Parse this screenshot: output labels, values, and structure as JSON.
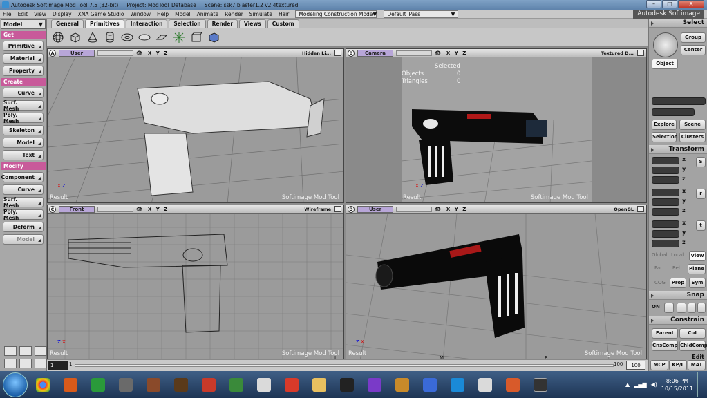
{
  "titlebar": {
    "app": "Autodesk Softimage Mod Tool 7.5 (32-bit)",
    "project": "Project: ModTool_Database",
    "scene": "Scene: ssk7 blaster1.2 v2.4textured",
    "buttons": [
      "–",
      "□",
      "X"
    ]
  },
  "menu": {
    "items": [
      "File",
      "Edit",
      "View",
      "Display",
      "XNA Game Studio",
      "Window",
      "Help",
      "Model",
      "Animate",
      "Render",
      "Simulate",
      "Hair"
    ],
    "construction_mode": "Modeling Construction Mode",
    "pass": "Default_Pass",
    "brand": "Autodesk Softimage"
  },
  "left": {
    "mode": "Model",
    "get_header": "Get",
    "get_items": [
      "Primitive",
      "Material",
      "Property"
    ],
    "create_header": "Create",
    "create_items": [
      "Curve",
      "Surf. Mesh",
      "Poly. Mesh",
      "Skeleton",
      "Model",
      "Text"
    ],
    "modify_header": "Modify",
    "modify_items": [
      "Component",
      "Curve",
      "Surf. Mesh",
      "Poly. Mesh",
      "Deform",
      "Model"
    ]
  },
  "tabs": [
    "General",
    "Primitives",
    "Interaction",
    "Selection",
    "Render",
    "Views",
    "Custom"
  ],
  "toolicons": [
    "sphere-icon",
    "cube-icon",
    "cone-icon",
    "cylinder-icon",
    "torus-icon",
    "disc-icon",
    "grid-icon",
    "null-icon",
    "soccer-icon",
    "model-icon"
  ],
  "viewports": {
    "a": {
      "letter": "A",
      "camera": "User",
      "xyz": "X Y Z",
      "mode": "Hidden Li...",
      "result": "Result",
      "footer": "Softimage Mod Tool"
    },
    "b": {
      "letter": "B",
      "camera": "Camera",
      "xyz": "X Y Z",
      "mode": "Textured D...",
      "result": "Result",
      "footer": "Softimage Mod Tool",
      "stats_title": "Selected",
      "objects_label": "Objects",
      "objects_val": "0",
      "triangles_label": "Triangles",
      "triangles_val": "0"
    },
    "c": {
      "letter": "C",
      "camera": "Front",
      "xyz": "X Y Z",
      "mode": "Wireframe",
      "result": "Result",
      "footer": "Softimage Mod Tool"
    },
    "d": {
      "letter": "D",
      "camera": "User",
      "xyz": "X Y Z",
      "mode": "OpenGL",
      "result": "Result",
      "footer": "Softimage Mod Tool"
    }
  },
  "right": {
    "select_header": "Select",
    "group": "Group",
    "center": "Center",
    "object": "Object",
    "explore": "Explore",
    "scene": "Scene",
    "selection": "Selection",
    "clusters": "Clusters",
    "transform_header": "Transform",
    "x": "x",
    "y": "y",
    "z": "z",
    "s": "S",
    "r": "r",
    "t": "t",
    "global": "Global",
    "local": "Local",
    "view": "View",
    "par": "Par",
    "rel": "Rel",
    "plane": "Plane",
    "cog": "COG",
    "prop": "Prop",
    "sym": "Sym",
    "snap_header": "Snap",
    "on": "ON",
    "constrain_header": "Constrain",
    "parent": "Parent",
    "cut": "Cut",
    "cnscomp": "CnsComp",
    "chldcomp": "ChldComp",
    "edit": "Edit",
    "mcp": "MCP",
    "kpl": "KP/L",
    "mat": "MAT"
  },
  "timeline": {
    "start": "1",
    "frame": "1",
    "end1": "100",
    "end2": "100",
    "l": "L",
    "m": "M",
    "r": "R"
  },
  "taskbar": {
    "time": "8:06 PM",
    "date": "10/15/2011"
  }
}
